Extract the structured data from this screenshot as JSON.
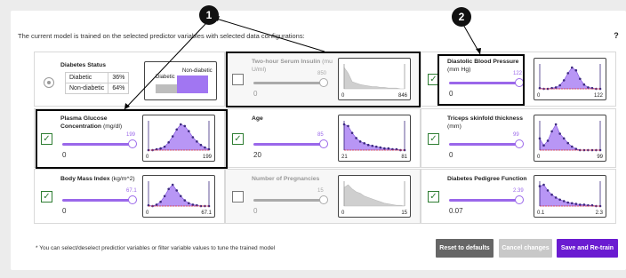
{
  "header": "The current model is trained on the selected predictor variables with selected data configurations:",
  "help_icon": "?",
  "callouts": [
    "1",
    "2"
  ],
  "target": {
    "title": "Diabetes Status",
    "rows": [
      {
        "label": "Diabetic",
        "value": "36%"
      },
      {
        "label": "Non-diabetic",
        "value": "64%"
      }
    ],
    "bar_labels": {
      "left": "Diabetic",
      "right": "Non-diabetic"
    },
    "diabetic_fraction": 0.36
  },
  "variables": [
    {
      "key": "glucose",
      "title": "Plasma Glucose Concentration",
      "unit": "(mg/dl)",
      "selected": true,
      "min": "0",
      "max": "199",
      "tick_min": "0",
      "tick_max": "199"
    },
    {
      "key": "insulin",
      "title": "Two-hour Serum Insulin",
      "unit": "(mu U/ml)",
      "selected": false,
      "min": "0",
      "max": "850",
      "tick_min": "0",
      "tick_max": "846"
    },
    {
      "key": "bp",
      "title": "Diastolic Blood Pressure",
      "unit": "(mm Hg)",
      "selected": true,
      "min": "0",
      "max": "122",
      "tick_min": "0",
      "tick_max": "122"
    },
    {
      "key": "age",
      "title": "Age",
      "unit": "",
      "selected": true,
      "min": "20",
      "max": "85",
      "tick_min": "21",
      "tick_max": "81"
    },
    {
      "key": "triceps",
      "title": "Triceps skinfold thickness",
      "unit": "(mm)",
      "selected": true,
      "min": "0",
      "max": "99",
      "tick_min": "0",
      "tick_max": "99"
    },
    {
      "key": "bmi",
      "title": "Body Mass Index",
      "unit": "(kg/m^2)",
      "selected": true,
      "min": "0",
      "max": "67.1",
      "tick_min": "0",
      "tick_max": "67.1"
    },
    {
      "key": "pregnancies",
      "title": "Number of Pregnancies",
      "unit": "",
      "selected": false,
      "min": "0",
      "max": "15",
      "tick_min": "0",
      "tick_max": "15"
    },
    {
      "key": "pedigree",
      "title": "Diabetes Pedigree Function",
      "unit": "",
      "selected": true,
      "min": "0.07",
      "max": "2.39",
      "tick_min": "0.1",
      "tick_max": "2.3"
    }
  ],
  "footnote": "* You can select/deselect predictior variables or filter variable values to tune the trained model",
  "buttons": {
    "reset": "Reset to defaults",
    "cancel": "Cancel changes",
    "save": "Save and Re-train"
  },
  "colors": {
    "accent": "#9a67ea",
    "dark_accent": "#3d2a80",
    "reset_bg": "#666666",
    "cancel_bg": "#c8c8c8",
    "save_bg": "#6a1bd1",
    "check": "#2e7d32"
  }
}
